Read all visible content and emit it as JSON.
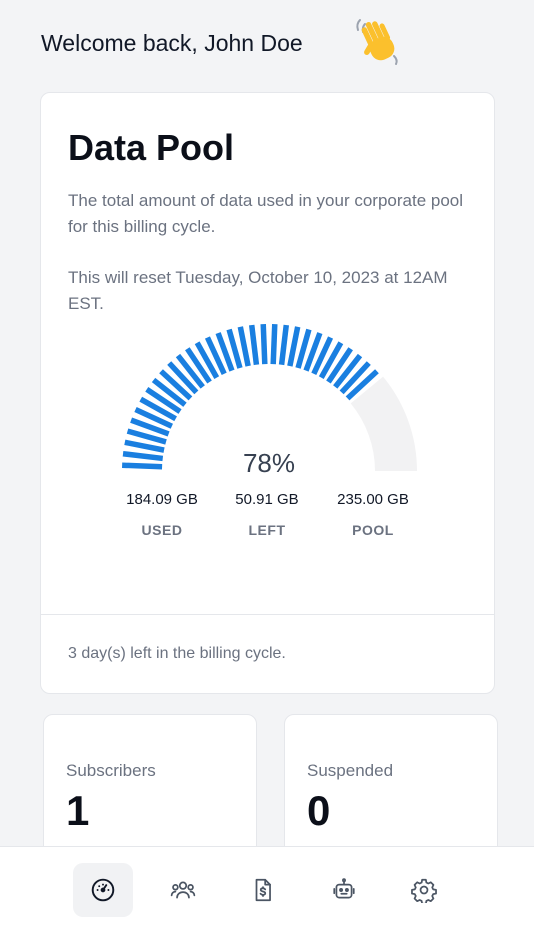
{
  "header": {
    "welcome": "Welcome back, John Doe",
    "wave_icon": "waving-hand-icon"
  },
  "data_pool": {
    "title": "Data Pool",
    "description": "The total amount of data used in your corporate pool for this billing cycle.",
    "reset_note": "This will reset Tuesday, October 10, 2023 at 12AM EST.",
    "percent_label": "78%",
    "percent_used": 78,
    "stats": [
      {
        "value": "184.09 GB",
        "label": "USED"
      },
      {
        "value": "50.91 GB",
        "label": "LEFT"
      },
      {
        "value": "235.00 GB",
        "label": "POOL"
      }
    ],
    "cycle_note": "3 day(s) left in the billing cycle.",
    "colors": {
      "used": "#1a7fe0",
      "remaining": "#f2f2f3"
    }
  },
  "cards": [
    {
      "label": "Subscribers",
      "value": "1"
    },
    {
      "label": "Suspended",
      "value": "0"
    }
  ],
  "tabbar": {
    "items": [
      {
        "icon": "dashboard-gauge-icon",
        "active": true
      },
      {
        "icon": "users-icon",
        "active": false
      },
      {
        "icon": "invoice-dollar-icon",
        "active": false
      },
      {
        "icon": "robot-icon",
        "active": false
      },
      {
        "icon": "gear-icon",
        "active": false
      }
    ]
  }
}
